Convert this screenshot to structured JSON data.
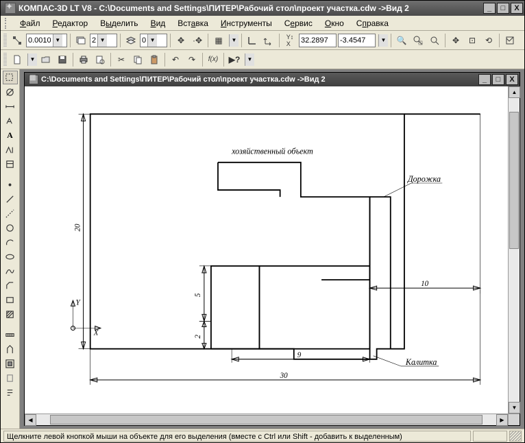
{
  "app": {
    "title": "КОМПАС-3D LT V8 - C:\\Documents and Settings\\ПИТЕР\\Рабочий стол\\проект участка.cdw ->Вид 2"
  },
  "menu": {
    "file": "Файл",
    "edit": "Редактор",
    "select": "Выделить",
    "view": "Вид",
    "insert": "Вставка",
    "tools": "Инструменты",
    "service": "Сервис",
    "window": "Окно",
    "help": "Справка"
  },
  "toolbar1": {
    "step": "0.0010",
    "layer_num": "2",
    "layer_idx": "0",
    "coord_x": "32.2897",
    "coord_y": "-3.4547"
  },
  "doc": {
    "title": "C:\\Documents and Settings\\ПИТЕР\\Рабочий стол\\проект участка.cdw ->Вид 2"
  },
  "drawing": {
    "label_host": "хозяйственный объект",
    "label_path": "Дорожка",
    "label_gate": "Калитка",
    "dim_20": "20",
    "dim_5": "5",
    "dim_2": "2",
    "dim_9": "9",
    "dim_30": "30",
    "dim_10": "10",
    "axis_x": "X",
    "axis_y": "Y"
  },
  "status": {
    "hint": "Щелкните левой кнопкой мыши на объекте для его выделения (вместе с Ctrl или Shift - добавить к выделенным)"
  }
}
